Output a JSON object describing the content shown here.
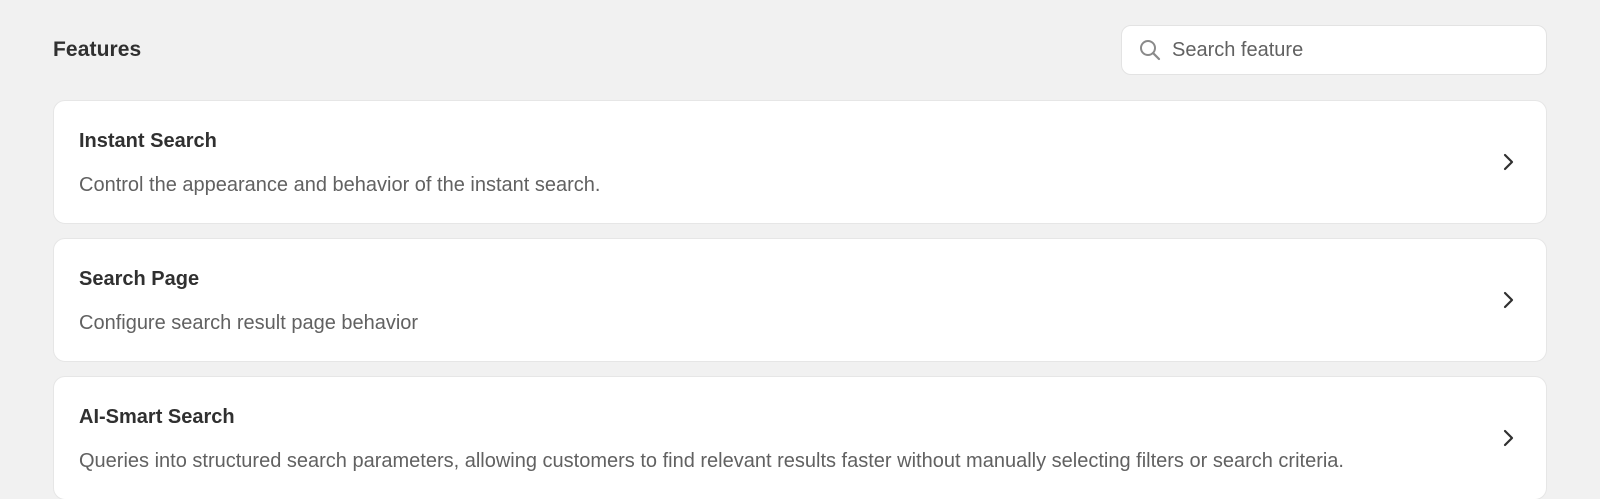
{
  "header": {
    "title": "Features",
    "search": {
      "placeholder": "Search feature",
      "value": "",
      "icon": "search-icon"
    }
  },
  "features": [
    {
      "title": "Instant Search",
      "description": "Control the appearance and behavior of the instant search.",
      "icon": "chevron-right-icon"
    },
    {
      "title": "Search Page",
      "description": "Configure search result page behavior",
      "icon": "chevron-right-icon"
    },
    {
      "title": "AI-Smart Search",
      "description": "Queries into structured search parameters, allowing customers to find relevant results faster without manually selecting filters or search criteria.",
      "icon": "chevron-right-icon"
    }
  ],
  "colors": {
    "background": "#f1f1f1",
    "card": "#ffffff",
    "text_primary": "#303030",
    "text_secondary": "#616161",
    "border": "#e3e3e3"
  }
}
